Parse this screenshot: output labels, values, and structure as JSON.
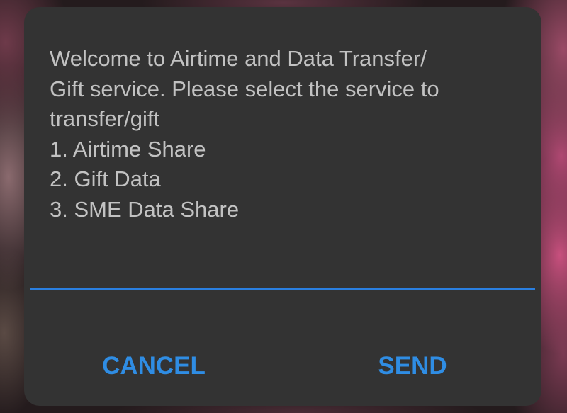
{
  "dialog": {
    "message": "Welcome to Airtime and Data Transfer/\nGift service. Please select the service to\ntransfer/gift\n1. Airtime Share\n2. Gift Data\n3. SME Data Share",
    "input_value": "",
    "cancel_label": "CANCEL",
    "send_label": "SEND"
  },
  "colors": {
    "dialog_background": "#333333",
    "message_text": "#c2c2c2",
    "accent": "#2f8de4",
    "input_underline": "#2a7fe0"
  }
}
